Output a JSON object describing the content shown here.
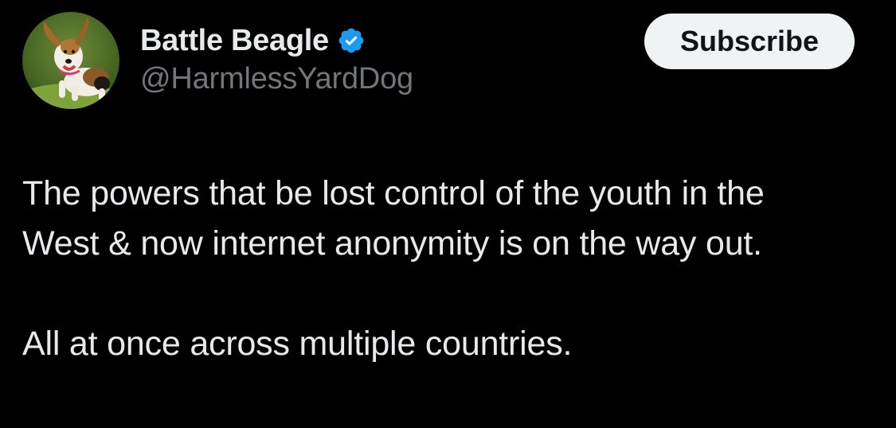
{
  "tweet": {
    "author": {
      "display_name": "Battle Beagle",
      "handle": "@HarmlessYardDog",
      "verified_badge_color": "#1d9bf0",
      "avatar_icon": "beagle-dog-photo"
    },
    "subscribe_label": "Subscribe",
    "text_lines": [
      "The powers that be lost control of the youth in the",
      "West & now internet anonymity is on the way out."
    ],
    "text_paragraph_2": "All at once across multiple countries."
  },
  "colors": {
    "background": "#000000",
    "primary_text": "#e7e9ea",
    "secondary_text": "#71767b",
    "button_bg": "#eff3f4",
    "button_text": "#0f1419"
  }
}
